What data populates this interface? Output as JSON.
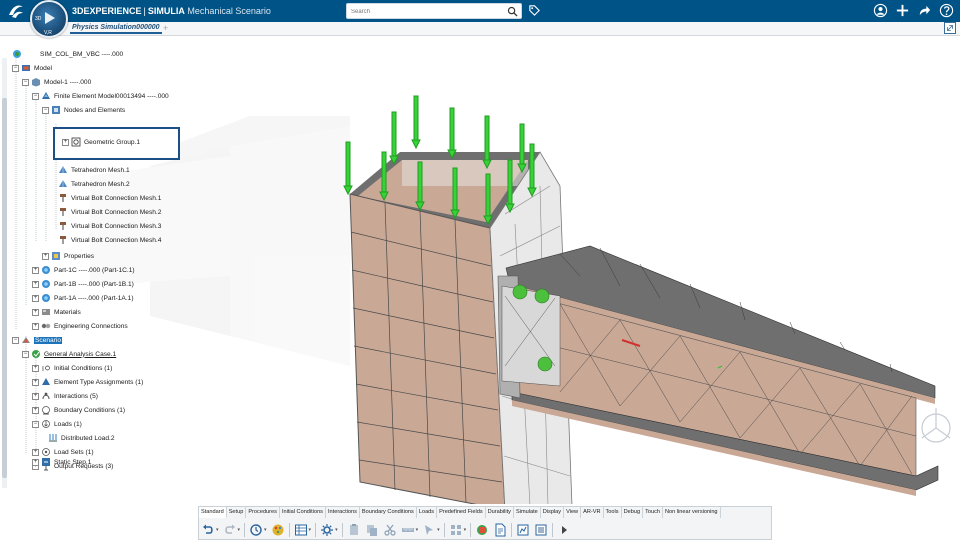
{
  "app": {
    "brand_bold": "3DEXPERIENCE",
    "separator": "|",
    "brand_product": "SIMULIA",
    "app_name": "Mechanical Scenario",
    "compass_label": "3D",
    "compass_version": "V,R"
  },
  "search": {
    "placeholder": "Search",
    "value": ""
  },
  "tabs": [
    {
      "label": "Physics Simulation000000",
      "active": true
    }
  ],
  "tree": {
    "root": "SIM_COL_BM_VBC ----.000",
    "items": [
      {
        "label": "Model"
      },
      {
        "label": "Model-1 ----.000"
      },
      {
        "label": "Finite Element Model00013494 ----.000"
      },
      {
        "label": "Nodes and Elements"
      },
      {
        "label": "Geometric Group.1"
      },
      {
        "label": "Tetrahedron Mesh.1"
      },
      {
        "label": "Tetrahedron Mesh.2"
      },
      {
        "label": "Virtual Bolt Connection Mesh.1"
      },
      {
        "label": "Virtual Bolt Connection Mesh.2"
      },
      {
        "label": "Virtual Bolt Connection Mesh.3"
      },
      {
        "label": "Virtual Bolt Connection Mesh.4"
      },
      {
        "label": "Properties"
      },
      {
        "label": "Part-1C ----.000 (Part-1C.1)"
      },
      {
        "label": "Part-1B ----.000 (Part-1B.1)"
      },
      {
        "label": "Part-1A ----.000 (Part-1A.1)"
      },
      {
        "label": "Materials"
      },
      {
        "label": "Engineering Connections"
      },
      {
        "label": "Scenario",
        "selected": true
      },
      {
        "label": "General Analysis Case.1"
      },
      {
        "label": "Initial Conditions (1)"
      },
      {
        "label": "Element Type Assignments (1)"
      },
      {
        "label": "Interactions (5)"
      },
      {
        "label": "Boundary Conditions (1)"
      },
      {
        "label": "Loads (1)"
      },
      {
        "label": "Distributed Load.2"
      },
      {
        "label": "Load Sets (1)"
      },
      {
        "label": "Output Requests (3)"
      },
      {
        "label": "Static Step.1"
      }
    ]
  },
  "toolbar": {
    "tabs": [
      "Standard",
      "Setup",
      "Procedures",
      "Initial Conditions",
      "Interactions",
      "Boundary Conditions",
      "Loads",
      "Predefined Fields",
      "Durability",
      "Simulate",
      "Display",
      "View",
      "AR-VR",
      "Tools",
      "Debug",
      "Touch",
      "Non linear versioning"
    ],
    "active_tab": "Standard"
  },
  "colors": {
    "topbar": "#005386",
    "mesh_tan": "#c9a896",
    "mesh_grey": "#707070",
    "load_arrow": "#2ec42e",
    "selection": "#1c73b9",
    "highlight_frame": "#1b4f86"
  },
  "icons": [
    "ds-logo-icon",
    "search-icon",
    "tag-icon",
    "user-icon",
    "plus-icon",
    "share-icon",
    "help-icon",
    "expand-icon"
  ]
}
